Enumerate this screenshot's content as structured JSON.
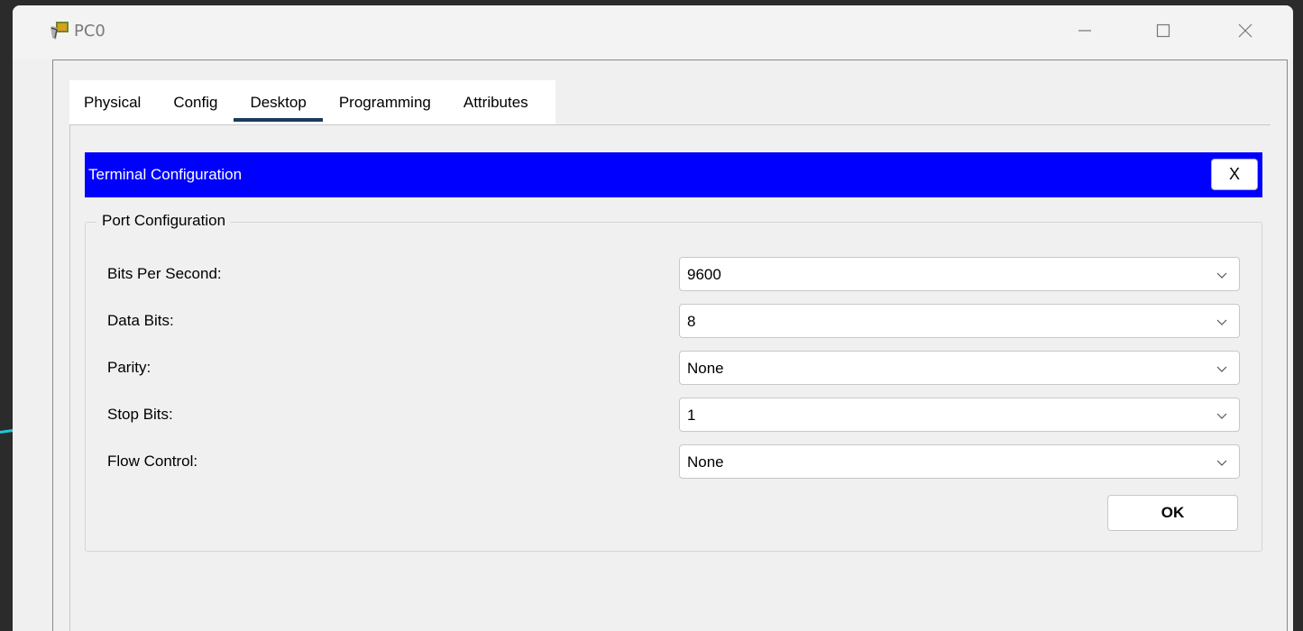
{
  "window": {
    "title": "PC0"
  },
  "tabs": [
    {
      "label": "Physical"
    },
    {
      "label": "Config"
    },
    {
      "label": "Desktop",
      "active": true
    },
    {
      "label": "Programming"
    },
    {
      "label": "Attributes"
    }
  ],
  "terminal": {
    "title": "Terminal Configuration",
    "close_label": "X"
  },
  "port_config": {
    "legend": "Port Configuration",
    "fields": [
      {
        "label": "Bits Per Second:",
        "value": "9600"
      },
      {
        "label": "Data Bits:",
        "value": "8"
      },
      {
        "label": "Parity:",
        "value": "None"
      },
      {
        "label": "Stop Bits:",
        "value": "1"
      },
      {
        "label": "Flow Control:",
        "value": "None"
      }
    ],
    "ok_label": "OK"
  },
  "colors": {
    "header_bg": "#0000ff",
    "active_tab_underline": "#1b3a5c"
  }
}
